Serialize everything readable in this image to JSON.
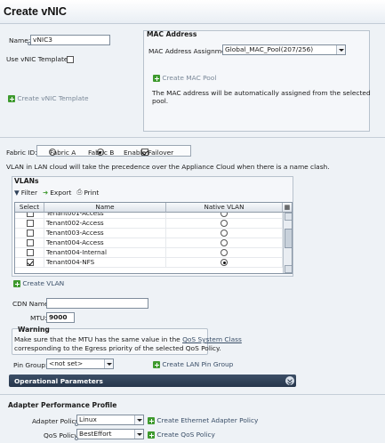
{
  "title": "Create vNIC",
  "name": {
    "label": "Name:",
    "value": "vNIC3"
  },
  "use_template": {
    "label": "Use vNIC Template:"
  },
  "create_vnic_template": "Create vNIC Template",
  "mac": {
    "title": "MAC Address",
    "assignment_label": "MAC Address Assignment:",
    "assignment_value": "Global_MAC_Pool(207/256)",
    "create_pool": "Create MAC Pool",
    "note": "The MAC address will be automatically assigned from the selected pool."
  },
  "fabric": {
    "label": "Fabric ID:",
    "option_a": "Fabric A",
    "option_b": "Fabric B",
    "selected": "Fabric B",
    "enable_failover": "Enable Failover"
  },
  "vlan_note": "VLAN in LAN cloud will take the precedence over the Appliance Cloud when there is a name clash.",
  "vlans": {
    "title": "VLANs",
    "toolbar": {
      "filter": "Filter",
      "export": "Export",
      "print": "Print"
    },
    "columns": [
      "Select",
      "Name",
      "Native VLAN"
    ],
    "rows": [
      {
        "name": "Tenant001-Access",
        "selected": false,
        "native": false
      },
      {
        "name": "Tenant002-Access",
        "selected": false,
        "native": false
      },
      {
        "name": "Tenant003-Access",
        "selected": false,
        "native": false
      },
      {
        "name": "Tenant004-Access",
        "selected": false,
        "native": false
      },
      {
        "name": "Tenant004-Internal",
        "selected": false,
        "native": false
      },
      {
        "name": "Tenant004-NFS",
        "selected": true,
        "native": true
      }
    ]
  },
  "create_vlan": "Create VLAN",
  "cdn": {
    "label": "CDN Name:",
    "value": ""
  },
  "mtu": {
    "label": "MTU:",
    "value": "9000"
  },
  "warning": {
    "title": "Warning",
    "text_before": "Make sure that the MTU has the same value in the",
    "link": "QoS System Class",
    "text_after": "corresponding to the Egress priority of the selected QoS Policy."
  },
  "pin_group": {
    "label": "Pin Group:",
    "value": "<not set>",
    "create": "Create LAN Pin Group"
  },
  "operational": "Operational Parameters",
  "adapter": {
    "title": "Adapter Performance Profile",
    "adapter_policy_label": "Adapter Policy:",
    "adapter_policy_value": "Linux",
    "create_adapter_policy": "Create Ethernet Adapter Policy",
    "qos_label": "QoS Policy:",
    "qos_value": "BestEffort",
    "create_qos": "Create QoS Policy"
  },
  "colors": {
    "header_dark": "#2f4159",
    "link": "#3a4f68",
    "green_plus": "#3e9a2e"
  }
}
